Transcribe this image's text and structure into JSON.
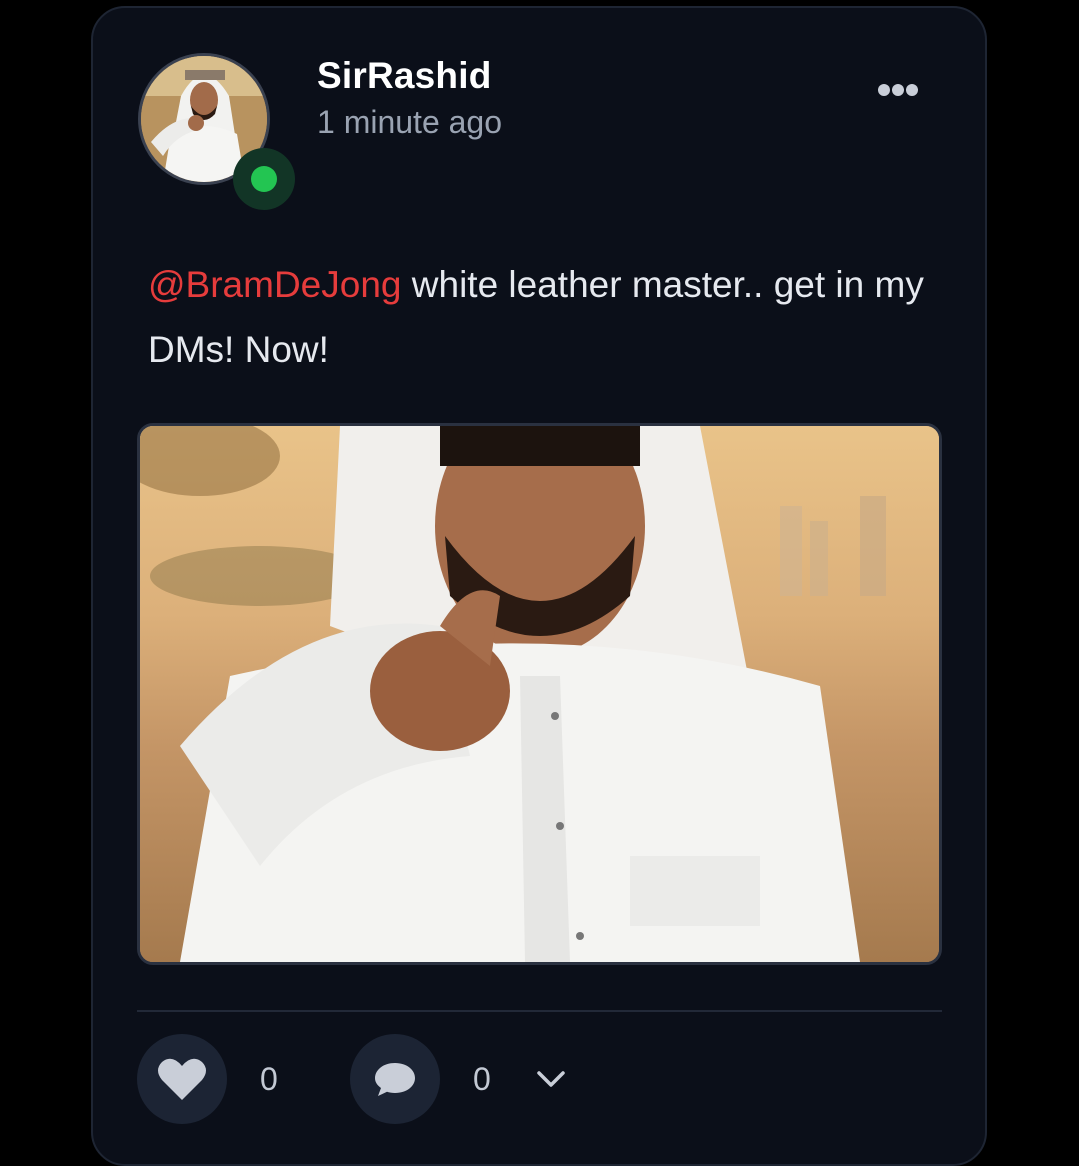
{
  "post": {
    "username": "SirRashid",
    "timestamp": "1 minute ago",
    "mention": "@BramDeJong",
    "body": " white leather master.. get in my DMs! Now!"
  },
  "actions": {
    "like_count": "0",
    "comment_count": "0"
  },
  "icons": {
    "more": "more-horizontal-icon",
    "like": "heart-icon",
    "comment": "comment-bubble-icon",
    "expand": "chevron-down-icon"
  },
  "colors": {
    "background": "#0b0f19",
    "mention": "#e63c3c",
    "online": "#23c552",
    "action_bg": "#1c2434"
  }
}
